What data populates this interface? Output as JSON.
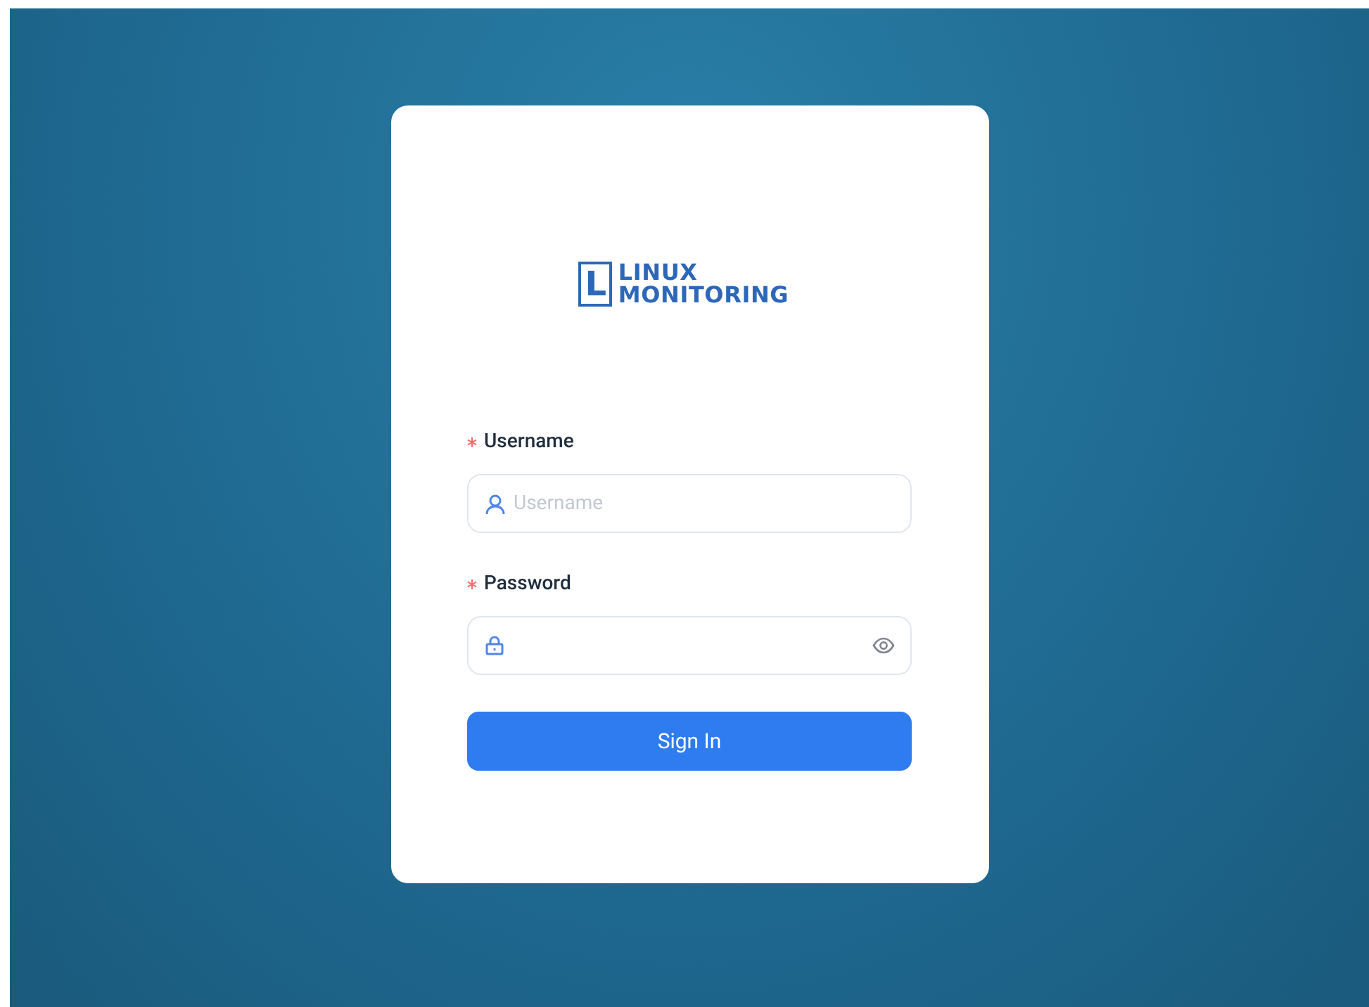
{
  "logo": {
    "mark": "L",
    "line_1": "LINUX",
    "line_2": "MONITORING"
  },
  "fields": [
    {
      "kind": "text",
      "label": "Username",
      "required": true,
      "placeholder": "Username"
    },
    {
      "kind": "password",
      "label": "Password",
      "required": true
    }
  ],
  "submit_button": "Sign In"
}
